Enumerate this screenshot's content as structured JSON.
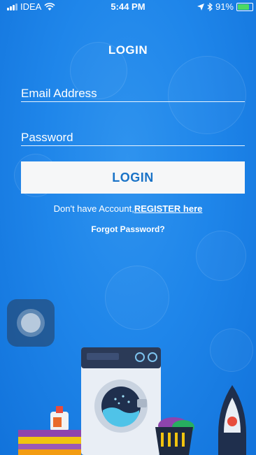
{
  "status_bar": {
    "carrier": "IDEA",
    "time": "5:44 PM",
    "battery": "91%",
    "battery_level": 0.91
  },
  "page": {
    "title": "LOGIN"
  },
  "form": {
    "email_placeholder": "Email Address",
    "password_placeholder": "Password",
    "login_label": "LOGIN"
  },
  "links": {
    "register_prefix": "Don't have Account,",
    "register_link": "REGISTER here",
    "forgot_password": "Forgot Password?"
  },
  "colors": {
    "background": "#1f86ea",
    "button_bg": "#f6f7f8",
    "button_text": "#1a73c7",
    "battery": "#4cd964"
  },
  "icons": [
    "signal-icon",
    "wifi-icon",
    "location-icon",
    "bluetooth-icon",
    "battery-icon",
    "assistive-touch-icon"
  ]
}
